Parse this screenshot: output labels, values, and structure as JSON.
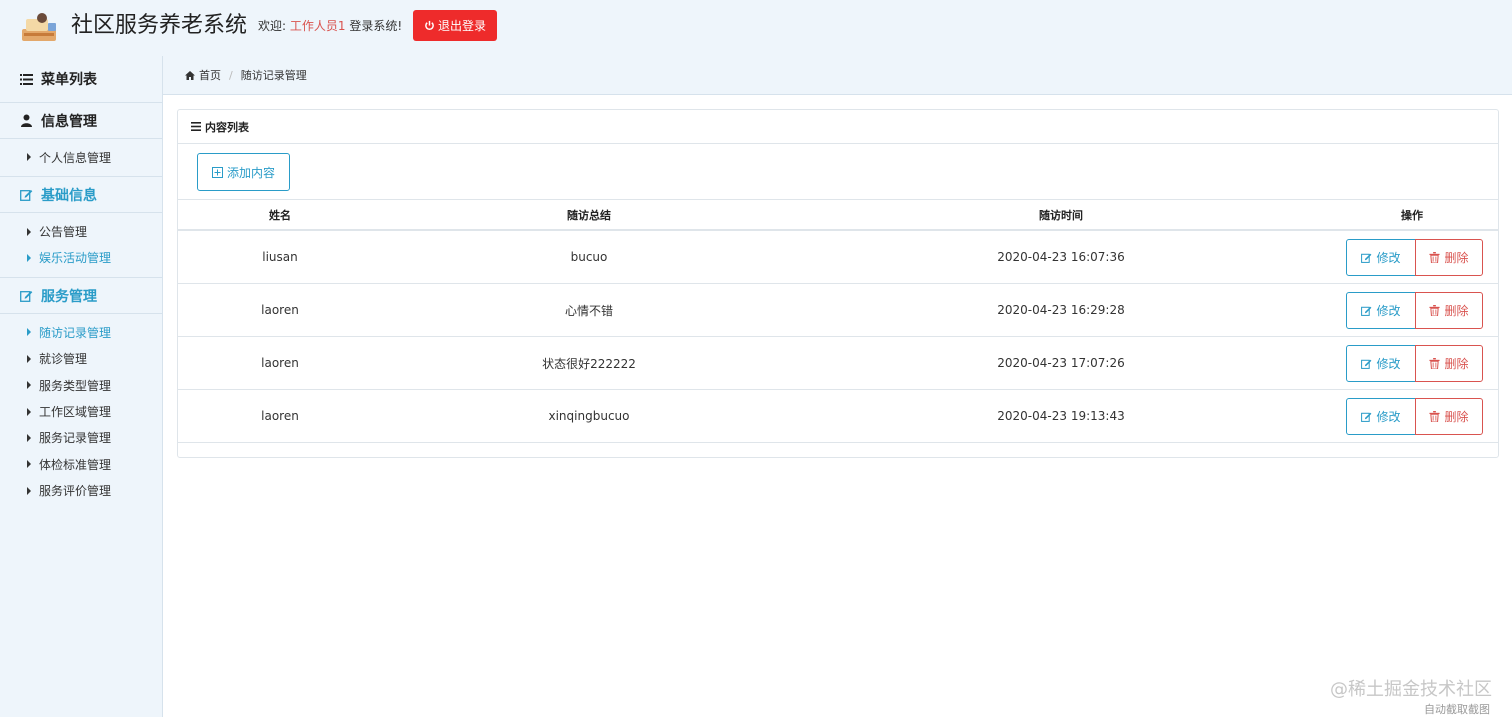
{
  "header": {
    "title": "社区服务养老系统",
    "welcome_prefix": "欢迎:",
    "user_name": "工作人员1",
    "welcome_suffix": "登录系统!",
    "logout_label": "退出登录",
    "logout_color": "#ee2b2b"
  },
  "sidebar": {
    "menu_title": "菜单列表",
    "groups": [
      {
        "label": "信息管理",
        "icon": "user-icon",
        "items": [
          {
            "label": "个人信息管理"
          }
        ]
      },
      {
        "label": "基础信息",
        "icon": "edit-icon",
        "items": [
          {
            "label": "公告管理"
          },
          {
            "label": "娱乐活动管理"
          }
        ]
      },
      {
        "label": "服务管理",
        "icon": "edit-icon",
        "items": [
          {
            "label": "随访记录管理"
          },
          {
            "label": "就诊管理"
          },
          {
            "label": "服务类型管理"
          },
          {
            "label": "工作区域管理"
          },
          {
            "label": "服务记录管理"
          },
          {
            "label": "体检标准管理"
          },
          {
            "label": "服务评价管理"
          }
        ]
      }
    ],
    "active_item": "随访记录管理",
    "accent_color": "#2a9cc8"
  },
  "breadcrumb": {
    "home": "首页",
    "current": "随访记录管理"
  },
  "panel": {
    "title": "内容列表",
    "add_label": "添加内容"
  },
  "table": {
    "columns": [
      "姓名",
      "随访总结",
      "随访时间",
      "操作"
    ],
    "edit_label": "修改",
    "delete_label": "删除",
    "rows": [
      {
        "name": "liusan",
        "summary": "bucuo",
        "time": "2020-04-23 16:07:36"
      },
      {
        "name": "laoren",
        "summary": "心情不错",
        "time": "2020-04-23 16:29:28"
      },
      {
        "name": "laoren",
        "summary": "状态很好222222",
        "time": "2020-04-23 17:07:26"
      },
      {
        "name": "laoren",
        "summary": "xinqingbucuo",
        "time": "2020-04-23 19:13:43"
      }
    ]
  },
  "watermark": {
    "text": "@稀土掘金技术社区",
    "small": "自动截取截图"
  }
}
